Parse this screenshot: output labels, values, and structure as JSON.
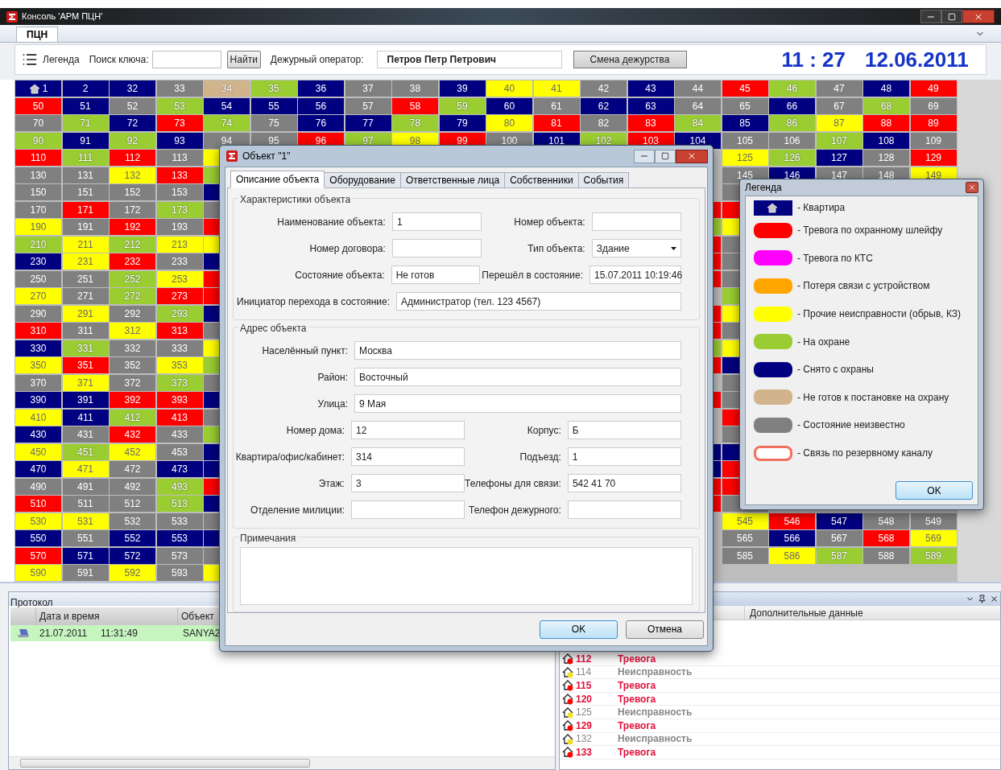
{
  "window": {
    "title": "Консоль 'АРМ ПЦН'"
  },
  "tabs": [
    {
      "label": "ПЦН",
      "selected": true
    }
  ],
  "toolbar": {
    "legend_label": "Легенда",
    "search_label": "Поиск ключа:",
    "find_button": "Найти",
    "operator_label": "Дежурный оператор:",
    "operator": "Петров Петр Петрович",
    "shift_button": "Смена дежурства",
    "time": "11 : 27",
    "date": "12.06.2011"
  },
  "grid": {
    "rows": [
      {
        "cells": [
          {
            "label": "1",
            "color": "#000080",
            "kind": "apartment"
          },
          {
            "label": "2",
            "color": "#000080"
          },
          {
            "label": "32",
            "color": "#000080"
          },
          {
            "label": "33",
            "color": "#808080"
          },
          {
            "label": "34",
            "color": "#d2b48c"
          },
          {
            "label": "35",
            "color": "#9acd32"
          },
          {
            "label": "36",
            "color": "#000080"
          },
          {
            "label": "37",
            "color": "#808080"
          },
          {
            "label": "38",
            "color": "#808080"
          },
          {
            "label": "39",
            "color": "#000080"
          },
          {
            "label": "40",
            "color": "#ffff00"
          },
          {
            "label": "41",
            "color": "#ffff00"
          },
          {
            "label": "42",
            "color": "#808080"
          },
          {
            "label": "43",
            "color": "#000080"
          },
          {
            "label": "44",
            "color": "#808080"
          },
          {
            "label": "45",
            "color": "#ff0000"
          },
          {
            "label": "46",
            "color": "#9acd32"
          },
          {
            "label": "47",
            "color": "#808080"
          },
          {
            "label": "48",
            "color": "#000080"
          },
          {
            "label": "49",
            "color": "#ff0000"
          }
        ]
      },
      {
        "cells": [
          {
            "label": "50",
            "color": "#ff0000"
          },
          {
            "label": "51",
            "color": "#000080"
          },
          {
            "label": "52",
            "color": "#808080"
          },
          {
            "label": "53",
            "color": "#9acd32"
          },
          {
            "label": "54",
            "color": "#000080"
          },
          {
            "label": "55",
            "color": "#000080"
          },
          {
            "label": "56",
            "color": "#000080"
          },
          {
            "label": "57",
            "color": "#808080"
          },
          {
            "label": "58",
            "color": "#ff0000"
          },
          {
            "label": "59",
            "color": "#9acd32"
          },
          {
            "label": "60",
            "color": "#000080"
          },
          {
            "label": "61",
            "color": "#808080"
          },
          {
            "label": "62",
            "color": "#000080"
          },
          {
            "label": "63",
            "color": "#000080"
          },
          {
            "label": "64",
            "color": "#808080"
          },
          {
            "label": "65",
            "color": "#808080"
          },
          {
            "label": "66",
            "color": "#000080"
          },
          {
            "label": "67",
            "color": "#808080"
          },
          {
            "label": "68",
            "color": "#9acd32"
          },
          {
            "label": "69",
            "color": "#808080"
          }
        ]
      },
      {
        "cells": [
          {
            "label": "70",
            "color": "#808080"
          },
          {
            "label": "71",
            "color": "#9acd32"
          },
          {
            "label": "72",
            "color": "#000080"
          },
          {
            "label": "73",
            "color": "#ff0000"
          },
          {
            "label": "74",
            "color": "#9acd32"
          },
          {
            "label": "75",
            "color": "#808080"
          },
          {
            "label": "76",
            "color": "#000080"
          },
          {
            "label": "77",
            "color": "#000080"
          },
          {
            "label": "78",
            "color": "#9acd32"
          },
          {
            "label": "79",
            "color": "#000080"
          },
          {
            "label": "80",
            "color": "#ffff00"
          },
          {
            "label": "81",
            "color": "#ff0000"
          },
          {
            "label": "82",
            "color": "#808080"
          },
          {
            "label": "83",
            "color": "#ff0000"
          },
          {
            "label": "84",
            "color": "#9acd32"
          },
          {
            "label": "85",
            "color": "#000080"
          },
          {
            "label": "86",
            "color": "#9acd32"
          },
          {
            "label": "87",
            "color": "#ffff00"
          },
          {
            "label": "88",
            "color": "#ff0000"
          },
          {
            "label": "89",
            "color": "#ff0000"
          }
        ]
      },
      {
        "cells": [
          {
            "label": "90",
            "color": "#9acd32"
          },
          {
            "label": "91",
            "color": "#000080"
          },
          {
            "label": "92",
            "color": "#9acd32"
          },
          {
            "label": "93",
            "color": "#000080"
          },
          {
            "label": "94",
            "color": "#808080"
          },
          {
            "label": "95",
            "color": "#808080"
          },
          {
            "label": "96",
            "color": "#ff0000"
          },
          {
            "label": "97",
            "color": "#9acd32"
          },
          {
            "label": "98",
            "color": "#ffff00"
          },
          {
            "label": "99",
            "color": "#ff0000"
          },
          {
            "label": "100",
            "color": "#808080"
          },
          {
            "label": "101",
            "color": "#000080"
          },
          {
            "label": "102",
            "color": "#9acd32"
          },
          {
            "label": "103",
            "color": "#ff0000"
          },
          {
            "label": "104",
            "color": "#000080"
          },
          {
            "label": "105",
            "color": "#808080"
          },
          {
            "label": "106",
            "color": "#808080"
          },
          {
            "label": "107",
            "color": "#9acd32"
          },
          {
            "label": "108",
            "color": "#000080"
          },
          {
            "label": "109",
            "color": "#808080"
          }
        ]
      },
      {
        "cells": [
          {
            "label": "110",
            "color": "#ff0000"
          },
          {
            "label": "111",
            "color": "#9acd32"
          },
          {
            "label": "112",
            "color": "#ff0000"
          },
          {
            "label": "113",
            "color": "#808080"
          },
          {
            "color": "#ffff00"
          },
          null,
          null,
          null,
          null,
          null,
          null,
          null,
          null,
          null,
          null,
          {
            "label": "125",
            "color": "#ffff00"
          },
          {
            "label": "126",
            "color": "#9acd32"
          },
          {
            "label": "127",
            "color": "#000080"
          },
          {
            "label": "128",
            "color": "#808080"
          },
          {
            "label": "129",
            "color": "#ff0000"
          }
        ]
      },
      {
        "cells": [
          {
            "label": "130",
            "color": "#808080"
          },
          {
            "label": "131",
            "color": "#808080"
          },
          {
            "label": "132",
            "color": "#ffff00"
          },
          {
            "label": "133",
            "color": "#ff0000"
          },
          {
            "color": "#9acd32"
          },
          null,
          null,
          null,
          null,
          null,
          null,
          null,
          null,
          null,
          null,
          {
            "label": "145",
            "color": "#808080"
          },
          {
            "label": "146",
            "color": "#000080"
          },
          {
            "label": "147",
            "color": "#808080"
          },
          {
            "label": "148",
            "color": "#808080"
          },
          {
            "label": "149",
            "color": "#ffff00"
          }
        ]
      },
      {
        "cells": [
          {
            "label": "150",
            "color": "#808080"
          },
          {
            "label": "151",
            "color": "#808080"
          },
          {
            "label": "152",
            "color": "#808080"
          },
          {
            "label": "153",
            "color": "#808080"
          },
          {
            "color": "#000080"
          },
          null,
          null,
          null,
          null,
          null,
          null,
          null,
          null,
          null,
          null,
          {
            "color": "#808080"
          },
          null,
          null,
          null,
          null
        ]
      },
      {
        "cells": [
          {
            "label": "170",
            "color": "#808080"
          },
          {
            "label": "171",
            "color": "#ff0000"
          },
          {
            "label": "172",
            "color": "#808080"
          },
          {
            "label": "173",
            "color": "#9acd32"
          },
          {
            "color": "#808080"
          },
          null,
          null,
          null,
          null,
          null,
          null,
          null,
          null,
          null,
          {
            "color": "#ff0000"
          },
          {
            "color": "#ff0000"
          },
          null,
          null,
          null,
          null
        ]
      },
      {
        "cells": [
          {
            "label": "190",
            "color": "#ffff00"
          },
          {
            "label": "191",
            "color": "#808080"
          },
          {
            "label": "192",
            "color": "#ff0000"
          },
          {
            "label": "193",
            "color": "#808080"
          },
          {
            "color": "#ff0000"
          },
          null,
          null,
          null,
          null,
          null,
          null,
          null,
          null,
          null,
          {
            "color": "#9acd32"
          },
          {
            "color": "#ffff00"
          },
          null,
          null,
          null,
          null
        ]
      },
      {
        "cells": [
          {
            "label": "210",
            "color": "#9acd32"
          },
          {
            "label": "211",
            "color": "#ffff00"
          },
          {
            "label": "212",
            "color": "#9acd32"
          },
          {
            "label": "213",
            "color": "#ffff00"
          },
          {
            "color": "#ffff00"
          },
          null,
          null,
          null,
          null,
          null,
          null,
          null,
          null,
          null,
          {
            "color": "#ff0000"
          },
          {
            "color": "#808080"
          },
          null,
          null,
          null,
          null
        ]
      },
      {
        "cells": [
          {
            "label": "230",
            "color": "#000080"
          },
          {
            "label": "231",
            "color": "#ffff00"
          },
          {
            "label": "232",
            "color": "#ff0000"
          },
          {
            "label": "233",
            "color": "#808080"
          },
          {
            "color": "#000080"
          },
          null,
          null,
          null,
          null,
          null,
          null,
          null,
          null,
          null,
          {
            "color": "#ff0000"
          },
          {
            "color": "#808080"
          },
          null,
          null,
          null,
          null
        ]
      },
      {
        "cells": [
          {
            "label": "250",
            "color": "#808080"
          },
          {
            "label": "251",
            "color": "#808080"
          },
          {
            "label": "252",
            "color": "#9acd32"
          },
          {
            "label": "253",
            "color": "#ffff00"
          },
          {
            "color": "#ff0000"
          },
          null,
          null,
          null,
          null,
          null,
          null,
          null,
          null,
          null,
          {
            "color": "#ff0000"
          },
          {
            "color": "#808080"
          },
          null,
          null,
          null,
          null
        ]
      },
      {
        "cells": [
          {
            "label": "270",
            "color": "#ffff00"
          },
          {
            "label": "271",
            "color": "#808080"
          },
          {
            "label": "272",
            "color": "#9acd32"
          },
          {
            "label": "273",
            "color": "#ff0000"
          },
          {
            "color": "#ff0000"
          },
          null,
          null,
          null,
          null,
          null,
          null,
          null,
          null,
          null,
          null,
          {
            "color": "#9acd32"
          },
          null,
          null,
          null,
          null
        ]
      },
      {
        "cells": [
          {
            "label": "290",
            "color": "#808080"
          },
          {
            "label": "291",
            "color": "#ffff00"
          },
          {
            "label": "292",
            "color": "#808080"
          },
          {
            "label": "293",
            "color": "#9acd32"
          },
          {
            "color": "#000080"
          },
          null,
          null,
          null,
          null,
          null,
          null,
          null,
          null,
          null,
          {
            "color": "#ff0000"
          },
          {
            "color": "#ffff00"
          },
          null,
          null,
          null,
          null
        ]
      },
      {
        "cells": [
          {
            "label": "310",
            "color": "#ff0000"
          },
          {
            "label": "311",
            "color": "#808080"
          },
          {
            "label": "312",
            "color": "#ffff00"
          },
          {
            "label": "313",
            "color": "#ff0000"
          },
          {
            "color": "#808080"
          },
          null,
          null,
          null,
          null,
          null,
          null,
          null,
          null,
          null,
          {
            "color": "#ff0000"
          },
          {
            "color": "#808080"
          },
          null,
          null,
          null,
          null
        ]
      },
      {
        "cells": [
          {
            "label": "330",
            "color": "#000080"
          },
          {
            "label": "331",
            "color": "#9acd32"
          },
          {
            "label": "332",
            "color": "#808080"
          },
          {
            "label": "333",
            "color": "#808080"
          },
          {
            "color": "#ffff00"
          },
          null,
          null,
          null,
          null,
          null,
          null,
          null,
          null,
          null,
          {
            "color": "#9acd32"
          },
          {
            "color": "#ffff00"
          },
          null,
          null,
          null,
          null
        ]
      },
      {
        "cells": [
          {
            "label": "350",
            "color": "#ffff00"
          },
          {
            "label": "351",
            "color": "#ff0000"
          },
          {
            "label": "352",
            "color": "#808080"
          },
          {
            "label": "353",
            "color": "#ffff00"
          },
          {
            "color": "#9acd32"
          },
          null,
          null,
          null,
          null,
          null,
          null,
          null,
          null,
          null,
          {
            "color": "#ff0000"
          },
          {
            "color": "#000080"
          },
          null,
          null,
          null,
          null
        ]
      },
      {
        "cells": [
          {
            "label": "370",
            "color": "#808080"
          },
          {
            "label": "371",
            "color": "#ffff00"
          },
          {
            "label": "372",
            "color": "#808080"
          },
          {
            "label": "373",
            "color": "#9acd32"
          },
          {
            "color": "#808080"
          },
          null,
          null,
          null,
          null,
          null,
          null,
          null,
          null,
          null,
          null,
          {
            "color": "#808080"
          },
          null,
          null,
          null,
          null
        ]
      },
      {
        "cells": [
          {
            "label": "390",
            "color": "#000080"
          },
          {
            "label": "391",
            "color": "#000080"
          },
          {
            "label": "392",
            "color": "#ff0000"
          },
          {
            "label": "393",
            "color": "#ff0000"
          },
          {
            "color": "#000080"
          },
          null,
          null,
          null,
          null,
          null,
          null,
          null,
          null,
          null,
          {
            "color": "#ff0000"
          },
          {
            "color": "#808080"
          },
          null,
          null,
          null,
          null
        ]
      },
      {
        "cells": [
          {
            "label": "410",
            "color": "#ffff00"
          },
          {
            "label": "411",
            "color": "#000080"
          },
          {
            "label": "412",
            "color": "#9acd32"
          },
          {
            "label": "413",
            "color": "#ff0000"
          },
          {
            "color": "#808080"
          },
          null,
          null,
          null,
          null,
          null,
          null,
          null,
          null,
          null,
          null,
          {
            "color": "#ff0000"
          },
          null,
          null,
          null,
          null
        ]
      },
      {
        "cells": [
          {
            "label": "430",
            "color": "#000080"
          },
          {
            "label": "431",
            "color": "#808080"
          },
          {
            "label": "432",
            "color": "#ff0000"
          },
          {
            "label": "433",
            "color": "#808080"
          },
          {
            "color": "#9acd32"
          },
          null,
          null,
          null,
          null,
          null,
          null,
          null,
          null,
          null,
          null,
          {
            "color": "#808080"
          },
          null,
          null,
          null,
          null
        ]
      },
      {
        "cells": [
          {
            "label": "450",
            "color": "#ffff00"
          },
          {
            "label": "451",
            "color": "#9acd32"
          },
          {
            "label": "452",
            "color": "#ffff00"
          },
          {
            "label": "453",
            "color": "#808080"
          },
          {
            "color": "#000080"
          },
          null,
          null,
          null,
          null,
          null,
          null,
          null,
          null,
          null,
          {
            "color": "#000080"
          },
          {
            "color": "#000080"
          },
          null,
          null,
          null,
          null
        ]
      },
      {
        "cells": [
          {
            "label": "470",
            "color": "#000080"
          },
          {
            "label": "471",
            "color": "#ffff00"
          },
          {
            "label": "472",
            "color": "#808080"
          },
          {
            "label": "473",
            "color": "#000080"
          },
          {
            "color": "#000080"
          },
          null,
          null,
          null,
          null,
          null,
          null,
          null,
          null,
          null,
          {
            "color": "#000080"
          },
          {
            "color": "#ff0000"
          },
          null,
          null,
          null,
          null
        ]
      },
      {
        "cells": [
          {
            "label": "490",
            "color": "#808080"
          },
          {
            "label": "491",
            "color": "#808080"
          },
          {
            "label": "492",
            "color": "#808080"
          },
          {
            "label": "493",
            "color": "#9acd32"
          },
          {
            "color": "#ff0000"
          },
          null,
          null,
          null,
          null,
          null,
          null,
          null,
          null,
          null,
          {
            "color": "#ff0000"
          },
          {
            "color": "#ff0000"
          },
          null,
          null,
          null,
          null
        ]
      },
      {
        "cells": [
          {
            "label": "510",
            "color": "#ff0000"
          },
          {
            "label": "511",
            "color": "#808080"
          },
          {
            "label": "512",
            "color": "#808080"
          },
          {
            "label": "513",
            "color": "#9acd32"
          },
          {
            "color": "#000080"
          },
          null,
          null,
          null,
          null,
          null,
          null,
          null,
          null,
          null,
          {
            "color": "#ff0000"
          },
          {
            "color": "#808080"
          },
          null,
          null,
          null,
          null
        ]
      },
      {
        "cells": [
          {
            "label": "530",
            "color": "#ffff00"
          },
          {
            "label": "531",
            "color": "#ffff00"
          },
          {
            "label": "532",
            "color": "#808080"
          },
          {
            "label": "533",
            "color": "#808080"
          },
          {
            "color": "#808080"
          },
          null,
          null,
          null,
          null,
          null,
          null,
          null,
          null,
          null,
          null,
          {
            "label": "545",
            "color": "#ffff00"
          },
          {
            "label": "546",
            "color": "#ff0000"
          },
          {
            "label": "547",
            "color": "#000080"
          },
          {
            "label": "548",
            "color": "#808080"
          },
          {
            "label": "549",
            "color": "#808080"
          }
        ]
      },
      {
        "cells": [
          {
            "label": "550",
            "color": "#000080"
          },
          {
            "label": "551",
            "color": "#808080"
          },
          {
            "label": "552",
            "color": "#000080"
          },
          {
            "label": "553",
            "color": "#000080"
          },
          {
            "color": "#000080"
          },
          null,
          null,
          null,
          null,
          null,
          null,
          null,
          null,
          null,
          null,
          {
            "label": "565",
            "color": "#808080"
          },
          {
            "label": "566",
            "color": "#000080"
          },
          {
            "label": "567",
            "color": "#808080"
          },
          {
            "label": "568",
            "color": "#ff0000"
          },
          {
            "label": "569",
            "color": "#ffff00"
          }
        ]
      },
      {
        "cells": [
          {
            "label": "570",
            "color": "#ff0000"
          },
          {
            "label": "571",
            "color": "#000080"
          },
          {
            "label": "572",
            "color": "#000080"
          },
          {
            "label": "573",
            "color": "#808080"
          },
          {
            "color": "#808080"
          },
          null,
          null,
          null,
          null,
          null,
          null,
          null,
          null,
          null,
          null,
          {
            "label": "585",
            "color": "#808080"
          },
          {
            "label": "586",
            "color": "#ffff00"
          },
          {
            "label": "587",
            "color": "#9acd32"
          },
          {
            "label": "588",
            "color": "#808080"
          },
          {
            "label": "589",
            "color": "#9acd32"
          }
        ]
      },
      {
        "cells": [
          {
            "label": "590",
            "color": "#ffff00"
          },
          {
            "label": "591",
            "color": "#808080"
          },
          {
            "label": "592",
            "color": "#ffff00"
          },
          {
            "label": "593",
            "color": "#808080"
          },
          {
            "color": "#ffff00"
          },
          null,
          null,
          null,
          null,
          null,
          null,
          null,
          null,
          null,
          null,
          null,
          null,
          null,
          null,
          null
        ]
      }
    ]
  },
  "protocol": {
    "title": "Протокол",
    "columns": [
      "Дата и время",
      "Объект"
    ],
    "rows": [
      {
        "date": "21.07.2011",
        "time": "11:31:49",
        "object": "SANYA2",
        "selected": true
      }
    ]
  },
  "events": {
    "columns": [
      "Дополнительные данные"
    ],
    "rows": [
      {
        "number": "112",
        "type": "Тревога",
        "kind": "alarm"
      },
      {
        "number": "114",
        "type": "Неисправность",
        "kind": "fault"
      },
      {
        "number": "115",
        "type": "Тревога",
        "kind": "alarm"
      },
      {
        "number": "120",
        "type": "Тревога",
        "kind": "alarm"
      },
      {
        "number": "125",
        "type": "Неисправность",
        "kind": "fault"
      },
      {
        "number": "129",
        "type": "Тревога",
        "kind": "alarm"
      },
      {
        "number": "132",
        "type": "Неисправность",
        "kind": "fault"
      },
      {
        "number": "133",
        "type": "Тревога",
        "kind": "alarm"
      }
    ]
  },
  "object_dialog": {
    "title": "Объект \"1\"",
    "tabs": [
      {
        "label": "Описание объекта",
        "selected": true
      },
      {
        "label": "Оборудование",
        "selected": false
      },
      {
        "label": "Ответственные лица",
        "selected": false
      },
      {
        "label": "Собственники",
        "selected": false
      },
      {
        "label": "События",
        "selected": false
      }
    ],
    "characteristics": {
      "title": "Характеристики объекта",
      "rows": [
        {
          "fields": [
            {
              "label": "Наименование объекта:",
              "value": "1",
              "kind": "text"
            },
            {
              "label": "Номер объекта:",
              "kind": "text"
            }
          ]
        },
        {
          "fields": [
            {
              "label": "Номер договора:",
              "kind": "text"
            },
            {
              "label": "Тип объекта:",
              "value": "Здание",
              "kind": "select"
            }
          ]
        },
        {
          "fields": [
            {
              "label": "Состояние объекта:",
              "value": "Не готов",
              "kind": "text"
            },
            {
              "label": "Перешёл в состояние:",
              "value": "15.07.2011 10:19:46",
              "kind": "text"
            }
          ]
        },
        {
          "fields": [
            {
              "label": "Инициатор перехода в состояние:",
              "value": "Администратор (тел. 123 4567)",
              "kind": "text"
            }
          ]
        }
      ]
    },
    "address": {
      "title": "Адрес объекта",
      "rows": [
        {
          "fields": [
            {
              "label": "Населённый пункт:",
              "value": "Москва",
              "kind": "text"
            }
          ]
        },
        {
          "fields": [
            {
              "label": "Район:",
              "value": "Восточный",
              "kind": "text"
            }
          ]
        },
        {
          "fields": [
            {
              "label": "Улица:",
              "value": "9 Мая",
              "kind": "text"
            }
          ]
        },
        {
          "fields": [
            {
              "label": "Номер дома:",
              "value": "12",
              "kind": "text"
            },
            {
              "label": "Корпус:",
              "value": "Б",
              "kind": "text"
            }
          ]
        },
        {
          "fields": [
            {
              "label": "Квартира/офис/кабинет:",
              "value": "314",
              "kind": "text"
            },
            {
              "label": "Подъезд:",
              "value": "1",
              "kind": "text"
            }
          ]
        },
        {
          "fields": [
            {
              "label": "Этаж:",
              "value": "3",
              "kind": "text"
            },
            {
              "label": "Телефоны для связи:",
              "value": "542 41 70",
              "kind": "text"
            }
          ]
        },
        {
          "fields": [
            {
              "label": "Отделение милиции:",
              "kind": "text"
            },
            {
              "label": "Телефон дежурного:",
              "kind": "text"
            }
          ]
        }
      ]
    },
    "notes": {
      "title": "Примечания"
    },
    "buttons": [
      {
        "label": "OK",
        "focused": true
      },
      {
        "label": "Отмена",
        "focused": false
      }
    ]
  },
  "legend_dialog": {
    "title": "Легенда",
    "items": [
      {
        "kind": "icon",
        "color": "#000080",
        "label": "- Квартира"
      },
      {
        "kind": "fill",
        "color": "#ff0000",
        "label": "- Тревога по охранному шлейфу"
      },
      {
        "kind": "fill",
        "color": "#ff00ff",
        "label": "- Тревога по КТС"
      },
      {
        "kind": "fill",
        "color": "#ffa500",
        "label": "- Потеря связи с устройством"
      },
      {
        "kind": "fill",
        "color": "#ffff00",
        "label": "- Прочие неисправности (обрыв, КЗ)"
      },
      {
        "kind": "fill",
        "color": "#9acd32",
        "label": "- На охране"
      },
      {
        "kind": "fill",
        "color": "#000080",
        "label": "- Снято с охраны"
      },
      {
        "kind": "fill",
        "color": "#d2b48c",
        "label": "- Не готов к постановке на охрану"
      },
      {
        "kind": "fill",
        "color": "#808080",
        "label": "- Состояние неизвестно"
      },
      {
        "kind": "outline",
        "color": "#f07060",
        "label": "- Связь по резервному каналу"
      }
    ],
    "button": "OK"
  }
}
